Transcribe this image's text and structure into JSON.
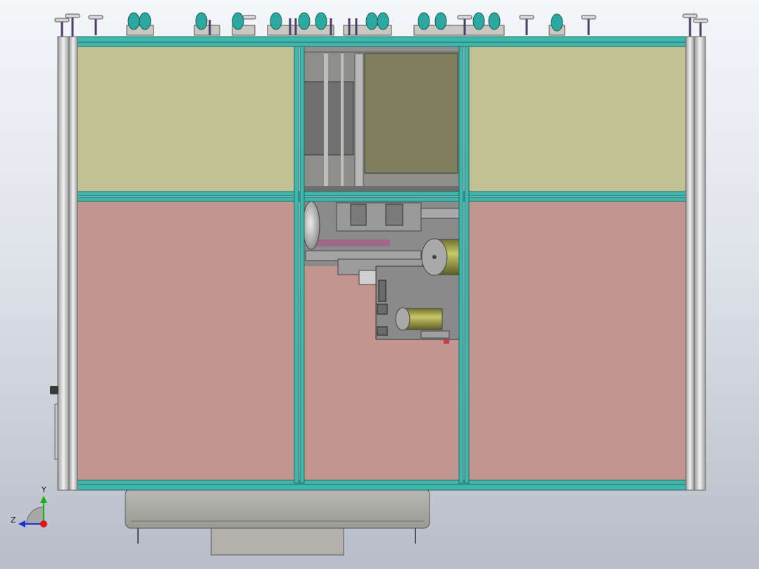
{
  "viewport": {
    "background_top": "#f4f6fa",
    "background_bottom": "#b7bdc9"
  },
  "model": {
    "view": "front",
    "frame_color": "#3fb7ad",
    "upper_panel_color": "#c2c193",
    "lower_panel_color": "#c2958e",
    "machine_gray": "#8c8c8c",
    "cylinder_color": "#9b9b3e"
  },
  "triad": {
    "y_axis_label": "Y",
    "z_axis_label": "Z",
    "y_axis_color": "#18b018",
    "z_axis_color": "#1c30d8",
    "origin_color": "#e01515"
  }
}
